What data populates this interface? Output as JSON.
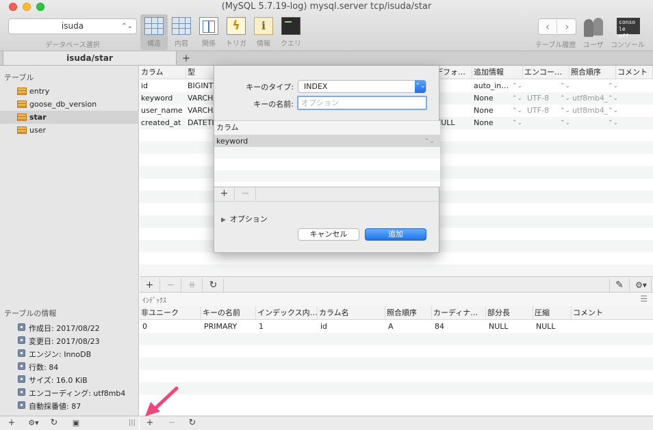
{
  "window": {
    "title": "(MySQL 5.7.19-log) mysql.server tcp/isuda/star"
  },
  "toolbar": {
    "database": "isuda",
    "database_caption": "データベース選択",
    "items": [
      {
        "label": "構造"
      },
      {
        "label": "内容"
      },
      {
        "label": "関係"
      },
      {
        "label": "トリガ"
      },
      {
        "label": "情報"
      },
      {
        "label": "クエリ"
      }
    ],
    "history_caption": "テーブル履歴",
    "users_caption": "ユーザ",
    "console_caption": "コンソール",
    "console_icon_text": "conso le off"
  },
  "tabs": {
    "active": "isuda/star",
    "add": "+"
  },
  "sidebar": {
    "heading": "テーブル",
    "tables": [
      "entry",
      "goose_db_version",
      "star",
      "user"
    ],
    "info_heading": "テーブルの情報",
    "info": [
      "作成日: 2017/08/22",
      "変更日: 2017/08/23",
      "エンジン: InnoDB",
      "行数: 84",
      "サイズ: 16.0 KiB",
      "エンコーディング: utf8mb4",
      "自動採番値: 87"
    ]
  },
  "structure": {
    "headers": [
      "カラム",
      "型",
      "デフォ…",
      "追加情報",
      "エンコー…",
      "照合順序",
      "コメント"
    ],
    "rows": [
      {
        "column": "id",
        "type": "BIGINT",
        "default": "",
        "extra": "auto_in…",
        "encoding": "",
        "collation": ""
      },
      {
        "column": "keyword",
        "type": "VARCHA",
        "default": "",
        "extra": "None",
        "encoding": "UTF-8",
        "collation": "utf8mb4_"
      },
      {
        "column": "user_name",
        "type": "VARCHA",
        "default": "",
        "extra": "None",
        "encoding": "UTF-8",
        "collation": "utf8mb4_"
      },
      {
        "column": "created_at",
        "type": "DATETI",
        "default": "NULL",
        "extra": "None",
        "encoding": "",
        "collation": ""
      }
    ]
  },
  "indexes": {
    "title": "ｲﾝﾃﾞｯｸｽ",
    "headers": [
      "非ユニーク",
      "キーの名前",
      "インデックス内…",
      "カラム名",
      "照合順序",
      "カーディナ…",
      "部分長",
      "圧縮",
      "コメント"
    ],
    "rows": [
      [
        "0",
        "PRIMARY",
        "1",
        "id",
        "A",
        "84",
        "NULL",
        "NULL",
        ""
      ]
    ]
  },
  "dialog": {
    "key_type_label": "キーのタイプ:",
    "key_type_value": "INDEX",
    "key_name_label": "キーの名前:",
    "key_name_placeholder": "オプション",
    "column_header": "カラム",
    "column_value": "keyword",
    "options_label": "オプション",
    "cancel": "キャンセル",
    "add": "追加"
  },
  "colors": {
    "accent": "#1f6fe6",
    "annotation": "#f0467a"
  }
}
